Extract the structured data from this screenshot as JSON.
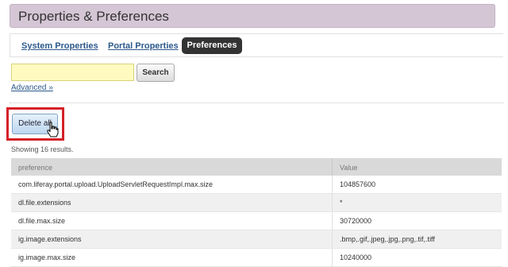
{
  "page": {
    "title": "Properties & Preferences"
  },
  "tabs": [
    {
      "label": "System Properties"
    },
    {
      "label": "Portal Properties"
    },
    {
      "label": "Preferences",
      "active": true
    }
  ],
  "search": {
    "value": "",
    "button_label": "Search",
    "advanced_label": "Advanced »"
  },
  "actions": {
    "delete_all_label": "Delete all"
  },
  "results": {
    "summary": "Showing 16 results."
  },
  "table": {
    "headers": {
      "preference": "preference",
      "value": "Value"
    },
    "rows": [
      {
        "preference": "com.liferay.portal.upload.UploadServletRequestImpl.max.size",
        "value": "104857600"
      },
      {
        "preference": "dl.file.extensions",
        "value": "*"
      },
      {
        "preference": "dl.file.max.size",
        "value": "30720000"
      },
      {
        "preference": "ig.image.extensions",
        "value": ".bmp,.gif,.jpeg,.jpg,.png,.tif,.tiff"
      },
      {
        "preference": "ig.image.max.size",
        "value": "10240000"
      }
    ]
  },
  "colors": {
    "title_bg": "#d5c6d6",
    "active_tab_bg": "#333333",
    "highlight": "#d62027",
    "search_bg": "#fffbc0"
  }
}
